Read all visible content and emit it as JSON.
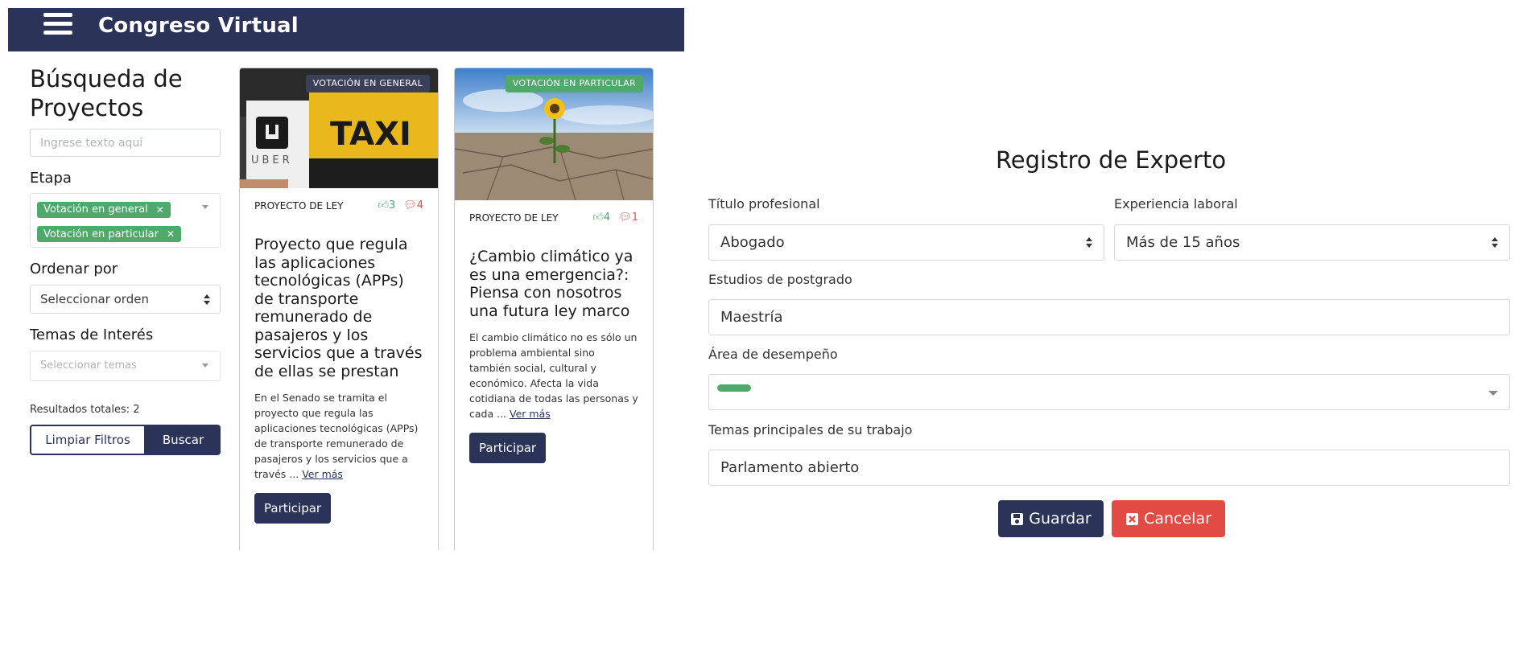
{
  "navbar": {
    "title": "Congreso Virtual"
  },
  "sidebar": {
    "title_line1": "Búsqueda de",
    "title_line2": "Proyectos",
    "search_placeholder": "Ingrese texto aquí",
    "stage_label": "Etapa",
    "stage_tags": [
      "Votación en general",
      "Votación en particular"
    ],
    "order_label": "Ordenar por",
    "order_value": "Seleccionar orden",
    "topics_label": "Temas de Interés",
    "topics_placeholder": "Seleccionar temas",
    "results": "Resultados totales: 2",
    "clear_button": "Limpiar Filtros",
    "search_button": "Buscar"
  },
  "cards": [
    {
      "badge": "VOTACIÓN EN GENERAL",
      "type": "PROYECTO DE LEY",
      "likes": "3",
      "comments": "4",
      "title": "Proyecto que regula las aplicaciones tecnológicas (APPs) de transporte remunerado de pasajeros y los servicios que a través de ellas se prestan",
      "text": "En el Senado se tramita el proyecto que regula las aplicaciones tecnológicas (APPs) de transporte remunerado de pasajeros y los servicios que a través ...",
      "more": "Ver más",
      "button": "Participar",
      "image_text_taxi": "TAXI",
      "image_text_uber": "UBER"
    },
    {
      "badge": "VOTACIÓN EN PARTICULAR",
      "type": "PROYECTO DE LEY",
      "likes": "4",
      "comments": "1",
      "title": "¿Cambio climático ya es una emergencia?: Piensa con nosotros una futura ley marco",
      "text": "El cambio climático no es sólo un problema ambiental sino también social, cultural y económico. Afecta la vida cotidiana de todas las personas y cada ...",
      "more": "Ver más",
      "button": "Participar"
    }
  ],
  "form": {
    "title": "Registro de Experto",
    "professional_title_label": "Título profesional",
    "professional_title_value": "Abogado",
    "experience_label": "Experiencia laboral",
    "experience_value": "Más de 15 años",
    "postgrad_label": "Estudios de postgrado",
    "postgrad_value": "Maestría",
    "area_label": "Área de desempeño",
    "topics_label": "Temas principales de su trabajo",
    "topics_value": "Parlamento abierto",
    "save_button": "Guardar",
    "cancel_button": "Cancelar"
  },
  "colors": {
    "navy": "#2b3358",
    "green": "#4fa96b",
    "red": "#e24b43"
  }
}
